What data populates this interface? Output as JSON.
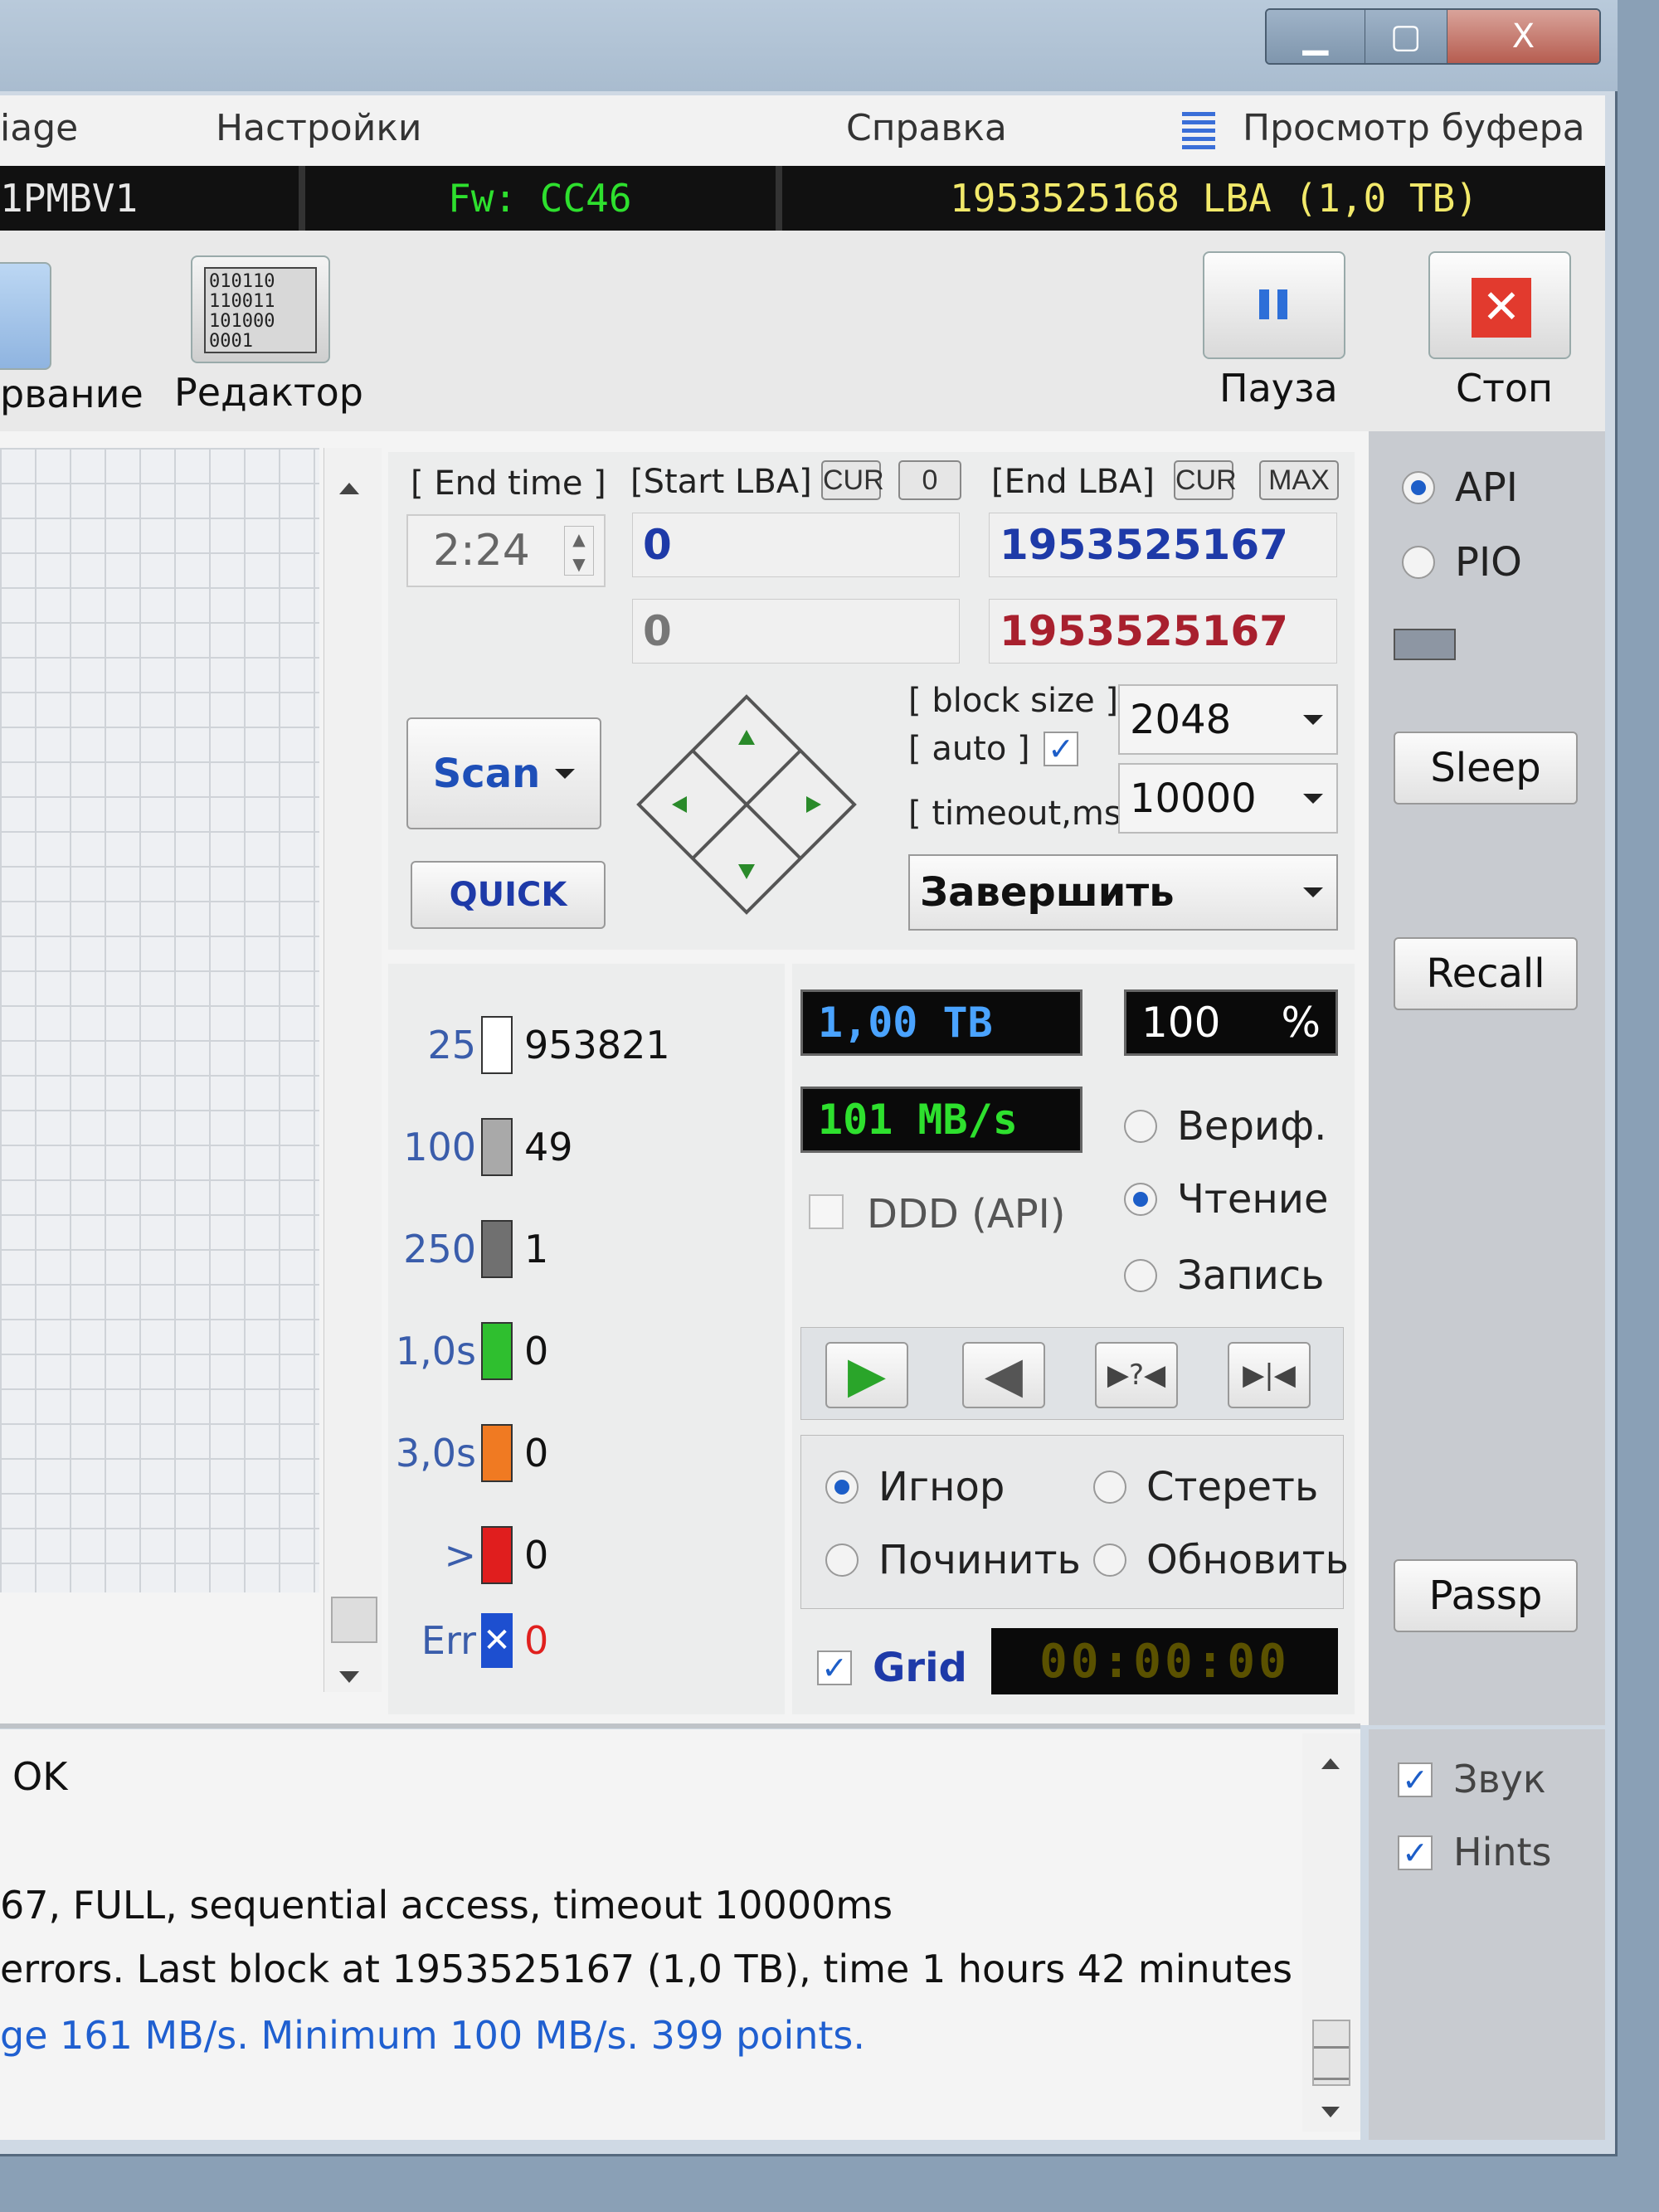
{
  "window": {
    "minimize": "▁",
    "maximize": "▢",
    "close": "X"
  },
  "menu": {
    "item1": "iage",
    "settings": "Настройки",
    "help": "Справка",
    "buffer": "Просмотр буфера"
  },
  "drive": {
    "model": "1PMBV1",
    "firmware": "Fw: CC46",
    "capacity": "1953525168 LBA (1,0 TB)"
  },
  "toolbar": {
    "testing_label": "рвание",
    "editor_label": "Редактор",
    "editor_icon_text": "010110\n110011\n101000\n0001",
    "pause_label": "Пауза",
    "stop_label": "Стоп"
  },
  "params": {
    "end_time_label": "[ End time ]",
    "end_time_value": "2:24",
    "start_lba_label": "[Start LBA]",
    "cur1": "CUR",
    "zero": "0",
    "end_lba_label": "[End LBA]",
    "cur2": "CUR",
    "max": "MAX",
    "start_lba_value": "0",
    "end_lba_value": "1953525167",
    "start_lba_cur": "0",
    "end_lba_cur": "1953525167",
    "block_size_label": "[ block size ]",
    "auto_label": "[ auto ]",
    "block_size_value": "2048",
    "timeout_label": "[ timeout,ms ]",
    "timeout_value": "10000",
    "scan_button": "Scan",
    "quick_button": "QUICK",
    "finish_select": "Завершить"
  },
  "legend": [
    {
      "threshold": "25",
      "count": "953821",
      "color": "#ffffff"
    },
    {
      "threshold": "100",
      "count": "49",
      "color": "#a9a9a9"
    },
    {
      "threshold": "250",
      "count": "1",
      "color": "#707070"
    },
    {
      "threshold": "1,0s",
      "count": "0",
      "color": "#2fbf2f"
    },
    {
      "threshold": "3,0s",
      "count": "0",
      "color": "#f07a22"
    },
    {
      "threshold": ">",
      "count": "0",
      "color": "#e01e1e"
    }
  ],
  "errors": {
    "label": "Err",
    "icon": "✕",
    "count": "0"
  },
  "status": {
    "size": "1,00 TB",
    "percent": "100",
    "percent_sign": "%",
    "speed": "101 MB/s",
    "ddd": "DDD (API)",
    "timer": "00:00:00"
  },
  "mode": {
    "verify": "Вериф.",
    "read": "Чтение",
    "write": "Запись"
  },
  "transport": {
    "play": "▶",
    "back": "◀",
    "skip": "▶?◀",
    "end": "▶|◀"
  },
  "actions": {
    "ignore": "Игнор",
    "erase": "Стереть",
    "repair": "Починить",
    "refresh": "Обновить"
  },
  "grid_label": "Grid",
  "interface": {
    "api": "API",
    "pio": "PIO"
  },
  "side_buttons": {
    "sleep": "Sleep",
    "recall": "Recall",
    "passp": "Passp"
  },
  "options": {
    "sound": "Звук",
    "hints": "Hints"
  },
  "log": [
    {
      "text": "OK",
      "color": "#222222"
    },
    {
      "text": "67, FULL, sequential access, timeout 10000ms",
      "color": "#222222"
    },
    {
      "text": "errors. Last block at 1953525167 (1,0 TB), time 1 hours 42 minutes ..",
      "color": "#222222"
    },
    {
      "text": "ge 161 MB/s. Minimum 100 MB/s. 399 points.",
      "color": "#1f5fd0"
    }
  ]
}
